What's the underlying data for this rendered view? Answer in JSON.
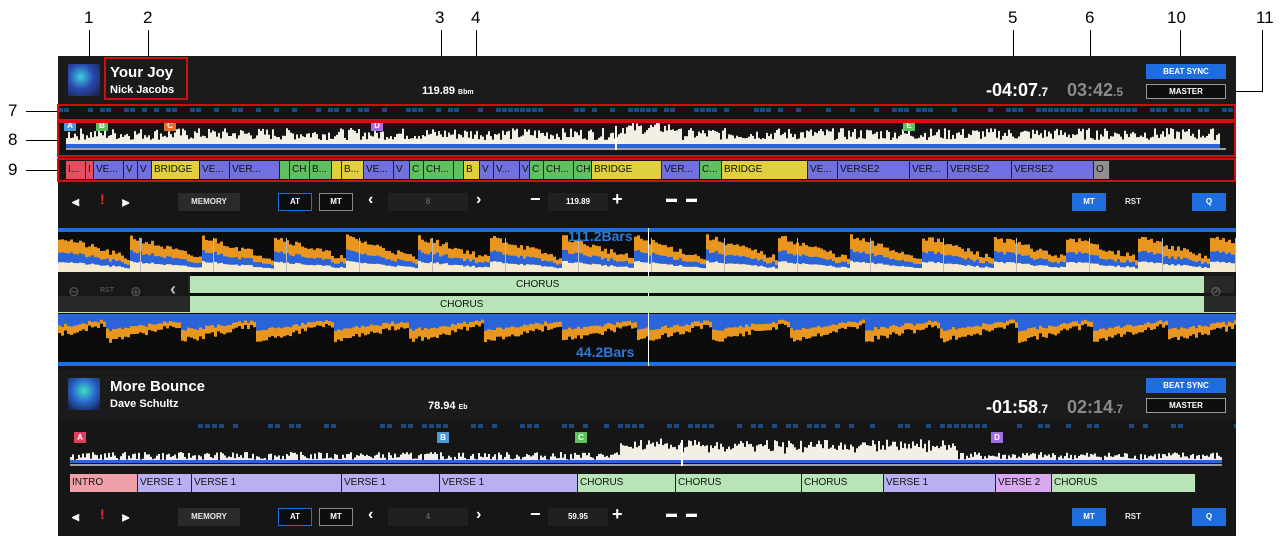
{
  "callouts": [
    "1",
    "2",
    "3",
    "4",
    "5",
    "6",
    "10",
    "11",
    "7",
    "8",
    "9"
  ],
  "deck1": {
    "title": "Your Joy",
    "artist": "Nick Jacobs",
    "bpm": "119.89",
    "key": "Bbm",
    "remaining_main": "-04:07",
    "remaining_frac": ".7",
    "total_main": "03:42",
    "total_frac": ".5",
    "beat_sync": "BEAT SYNC",
    "master": "MASTER",
    "cues": [
      "A",
      "B",
      "C",
      "D",
      "E"
    ],
    "phrases": [
      {
        "label": "I...",
        "color": "#e05060"
      },
      {
        "label": "I",
        "color": "#e05060"
      },
      {
        "label": "VE...",
        "color": "#7070e0"
      },
      {
        "label": "V",
        "color": "#7070e0"
      },
      {
        "label": "V",
        "color": "#7070e0"
      },
      {
        "label": "BRIDGE",
        "color": "#e0d040"
      },
      {
        "label": "VE...",
        "color": "#7070e0"
      },
      {
        "label": "VER...",
        "color": "#7070e0"
      },
      {
        "label": "",
        "color": "#60c060"
      },
      {
        "label": "CH",
        "color": "#60c060"
      },
      {
        "label": "B...",
        "color": "#60c060"
      },
      {
        "label": "",
        "color": "#e0d040"
      },
      {
        "label": "B...",
        "color": "#e0d040"
      },
      {
        "label": "VE...",
        "color": "#7070e0"
      },
      {
        "label": "V",
        "color": "#7070e0"
      },
      {
        "label": "C",
        "color": "#60c060"
      },
      {
        "label": "CH...",
        "color": "#60c060"
      },
      {
        "label": "",
        "color": "#60c060"
      },
      {
        "label": "B",
        "color": "#e0d040"
      },
      {
        "label": "V",
        "color": "#7070e0"
      },
      {
        "label": "V...",
        "color": "#7070e0"
      },
      {
        "label": "V",
        "color": "#7070e0"
      },
      {
        "label": "C",
        "color": "#60c060"
      },
      {
        "label": "CH...",
        "color": "#60c060"
      },
      {
        "label": "CH",
        "color": "#60c060"
      },
      {
        "label": "BRIDGE",
        "color": "#e0d040"
      },
      {
        "label": "VER...",
        "color": "#7070e0"
      },
      {
        "label": "C...",
        "color": "#60c060"
      },
      {
        "label": "BRIDGE",
        "color": "#e0d040"
      },
      {
        "label": "VE...",
        "color": "#7070e0"
      },
      {
        "label": "VERSE2",
        "color": "#7070e0"
      },
      {
        "label": "VER...",
        "color": "#7070e0"
      },
      {
        "label": "VERSE2",
        "color": "#7070e0"
      },
      {
        "label": "VERSE2",
        "color": "#7070e0"
      },
      {
        "label": "O",
        "color": "#909090"
      }
    ],
    "controls": {
      "memory": "MEMORY",
      "at": "AT",
      "mt": "MT",
      "memory_field": "8",
      "bpm_field": "119.89",
      "mt_right": "MT",
      "rst": "RST",
      "q": "Q"
    }
  },
  "zoom": {
    "bars_top": "111.2Bars",
    "bars_bottom": "44.2Bars",
    "phrase_top": "CHORUS",
    "phrase_bottom": "CHORUS"
  },
  "deck2": {
    "title": "More Bounce",
    "artist": "Dave Schultz",
    "bpm": "78.94",
    "key": "Eb",
    "remaining_main": "-01:58",
    "remaining_frac": ".7",
    "total_main": "02:14",
    "total_frac": ".7",
    "beat_sync": "BEAT SYNC",
    "master": "MASTER",
    "cues": [
      "A",
      "B",
      "C",
      "D"
    ],
    "phrases": [
      {
        "label": "INTRO",
        "color": "#f0a0a8"
      },
      {
        "label": "VERSE 1",
        "color": "#b8b0f0"
      },
      {
        "label": "VERSE 1",
        "color": "#b8b0f0"
      },
      {
        "label": "VERSE 1",
        "color": "#b8b0f0"
      },
      {
        "label": "VERSE 1",
        "color": "#b8b0f0"
      },
      {
        "label": "CHORUS",
        "color": "#b8e4b8"
      },
      {
        "label": "CHORUS",
        "color": "#b8e4b8"
      },
      {
        "label": "CHORUS",
        "color": "#b8e4b8"
      },
      {
        "label": "VERSE 1",
        "color": "#b8b0f0"
      },
      {
        "label": "VERSE 2",
        "color": "#d8a8f0"
      },
      {
        "label": "CHORUS",
        "color": "#b8e4b8"
      }
    ],
    "controls": {
      "memory": "MEMORY",
      "at": "AT",
      "mt": "MT",
      "memory_field": "4",
      "bpm_field": "59.95",
      "mt_right": "MT",
      "rst": "RST",
      "q": "Q"
    }
  },
  "colors": {
    "accent_blue": "#1e6ee0",
    "highlight_red": "#d01010",
    "wave_orange": "#e8961e",
    "wave_blue": "#2a64d8",
    "wave_cream": "#f4ead0"
  }
}
